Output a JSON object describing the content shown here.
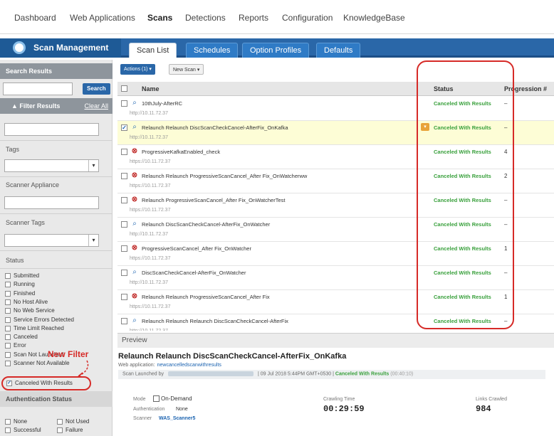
{
  "nav": {
    "items": [
      "Dashboard",
      "Web Applications",
      "Scans",
      "Detections",
      "Reports",
      "Configuration",
      "KnowledgeBase"
    ],
    "active": "Scans"
  },
  "module": {
    "title": "Scan Management",
    "tabs": [
      "Scan List",
      "Schedules",
      "Option Profiles",
      "Defaults"
    ],
    "active_tab": "Scan List"
  },
  "sidebar": {
    "search_results_header": "Search Results",
    "search_button": "Search",
    "filter_results_header": "Filter Results",
    "clear_all": "Clear All",
    "tags_label": "Tags",
    "scanner_appliance_label": "Scanner Appliance",
    "scanner_tags_label": "Scanner Tags",
    "status_label": "Status",
    "status_options": [
      {
        "label": "Submitted",
        "checked": false
      },
      {
        "label": "Running",
        "checked": false
      },
      {
        "label": "Finished",
        "checked": false
      },
      {
        "label": "No Host Alive",
        "checked": false
      },
      {
        "label": "No Web Service",
        "checked": false
      },
      {
        "label": "Service Errors Detected",
        "checked": false
      },
      {
        "label": "Time Limit Reached",
        "checked": false
      },
      {
        "label": "Canceled",
        "checked": false
      },
      {
        "label": "Error",
        "checked": false
      },
      {
        "label": "Scan Not Launched",
        "checked": false
      },
      {
        "label": "Scanner Not Available",
        "checked": false
      },
      {
        "label": "Canceled With Results",
        "checked": true
      }
    ],
    "annotation": "New Filter",
    "auth_status_header": "Authentication Status",
    "auth_options": [
      "None",
      "Not Used",
      "Successful",
      "Failure"
    ]
  },
  "toolbar": {
    "actions_label": "Actions (1) ▾",
    "new_scan_label": "New Scan ▾"
  },
  "table": {
    "columns": [
      "Name",
      "Status",
      "Progression #"
    ],
    "rows": [
      {
        "type": "scan",
        "name": "10thJuly-AfterRC",
        "url": "http://10.11.72.37",
        "status": "Canceled With Results",
        "progression": "–",
        "checked": false,
        "selected": false
      },
      {
        "type": "scan",
        "name": "Relaunch Relaunch DiscScanCheckCancel-AfterFix_OnKafka",
        "url": "http://10.11.72.37",
        "status": "Canceled With Results",
        "progression": "–",
        "checked": true,
        "selected": true
      },
      {
        "type": "progressive",
        "name": "ProgressiveKafkaEnabled_check",
        "url": "https://10.11.72.37",
        "status": "Canceled With Results",
        "progression": "4",
        "checked": false,
        "selected": false
      },
      {
        "type": "progressive",
        "name": "Relaunch Relaunch ProgressiveScanCancel_After Fix_OnWatcherww",
        "url": "https://10.11.72.37",
        "status": "Canceled With Results",
        "progression": "2",
        "checked": false,
        "selected": false
      },
      {
        "type": "progressive",
        "name": "Relaunch ProgressiveScanCancel_After Fix_OnWatcherTest",
        "url": "https://10.11.72.37",
        "status": "Canceled With Results",
        "progression": "–",
        "checked": false,
        "selected": false
      },
      {
        "type": "scan",
        "name": "Relaunch DiscScanCheckCancel-AfterFix_OnWatcher",
        "url": "http://10.11.72.37",
        "status": "Canceled With Results",
        "progression": "–",
        "checked": false,
        "selected": false
      },
      {
        "type": "progressive",
        "name": "ProgressiveScanCancel_After Fix_OnWatcher",
        "url": "https://10.11.72.37",
        "status": "Canceled With Results",
        "progression": "1",
        "checked": false,
        "selected": false
      },
      {
        "type": "scan",
        "name": "DiscScanCheckCancel-AfterFix_OnWatcher",
        "url": "http://10.11.72.37",
        "status": "Canceled With Results",
        "progression": "–",
        "checked": false,
        "selected": false
      },
      {
        "type": "progressive",
        "name": "Relaunch Relaunch ProgressiveScanCancel_After Fix",
        "url": "https://10.11.72.37",
        "status": "Canceled With Results",
        "progression": "1",
        "checked": false,
        "selected": false
      },
      {
        "type": "scan",
        "name": "Relaunch Relaunch Relaunch DiscScanCheckCancel-AfterFix",
        "url": "http://10.11.72.37",
        "status": "Canceled With Results",
        "progression": "–",
        "checked": false,
        "selected": false
      }
    ]
  },
  "preview": {
    "header": "Preview",
    "title": "Relaunch Relaunch DiscScanCheckCancel-AfterFix_OnKafka",
    "web_application_label": "Web application:",
    "web_application_value": "newcancelledscanwithresults",
    "launched_by_label": "Scan Launched by",
    "launched_date": "| 09 Jul 2018 5:44PM GMT+0530 |",
    "launched_status": "Canceled With Results",
    "launched_duration": "(00:40:10)",
    "mode_label": "Mode",
    "mode_value": "On-Demand",
    "auth_label": "Authentication",
    "auth_value": "None",
    "scanner_label": "Scanner",
    "scanner_value": "WAS_Scanner5",
    "crawling_time_label": "Crawling Time",
    "crawling_time_value": "00:29:59",
    "links_crawled_label": "Links Crawled",
    "links_crawled_value": "984"
  },
  "colors": {
    "brand_blue": "#2a67a8",
    "status_green": "#39a03c",
    "annotation_red": "#d62a27",
    "selected_row": "#fdfdd6"
  }
}
